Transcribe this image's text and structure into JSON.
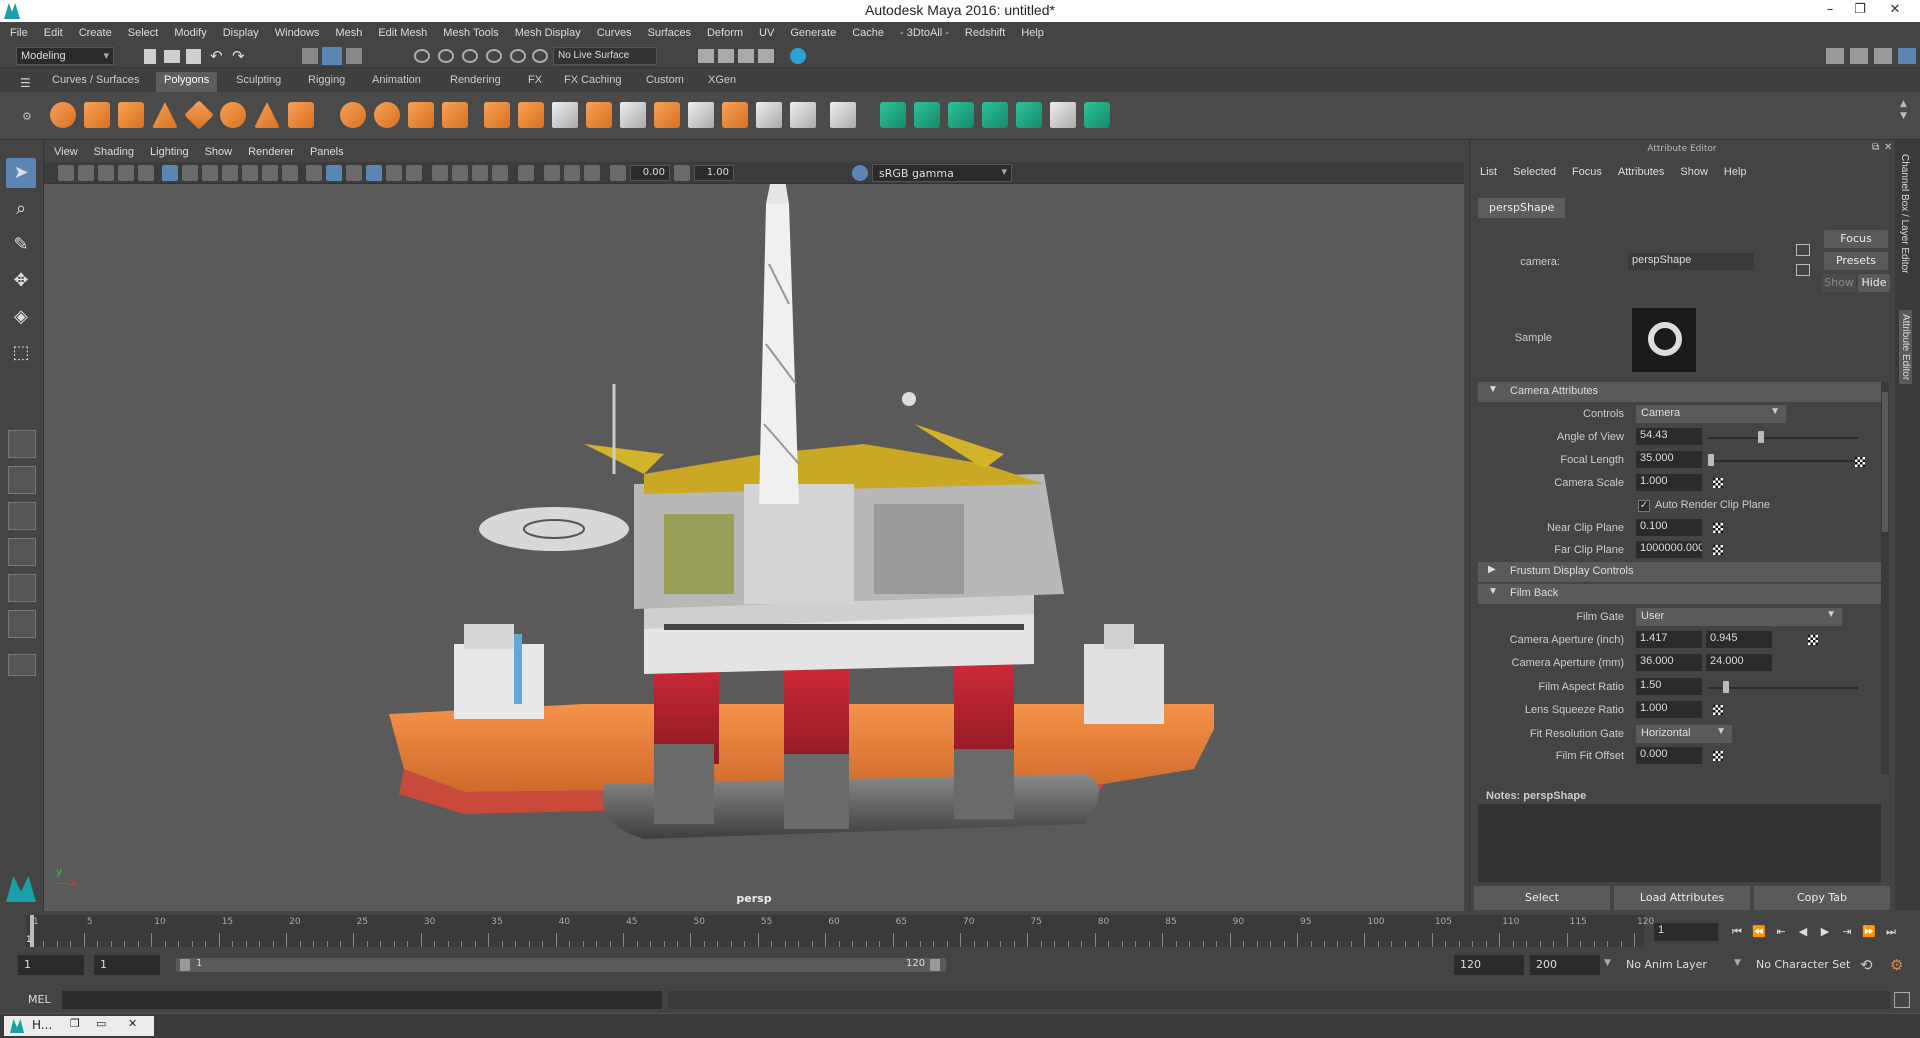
{
  "window": {
    "title": "Autodesk Maya 2016: untitled*"
  },
  "menus": [
    "File",
    "Edit",
    "Create",
    "Select",
    "Modify",
    "Display",
    "Windows",
    "Mesh",
    "Edit Mesh",
    "Mesh Tools",
    "Mesh Display",
    "Curves",
    "Surfaces",
    "Deform",
    "UV",
    "Generate",
    "Cache",
    "- 3DtoAll -",
    "Redshift",
    "Help"
  ],
  "status": {
    "mode": "Modeling",
    "live_surface": "No Live Surface"
  },
  "shelf": {
    "tabs": [
      "Curves / Surfaces",
      "Polygons",
      "Sculpting",
      "Rigging",
      "Animation",
      "Rendering",
      "FX",
      "FX Caching",
      "Custom",
      "XGen"
    ],
    "active_tab": "Polygons"
  },
  "viewport": {
    "menus": [
      "View",
      "Shading",
      "Lighting",
      "Show",
      "Renderer",
      "Panels"
    ],
    "near_value": "0.00",
    "exposure_value": "1.00",
    "color_space": "sRGB gamma",
    "camera_label": "persp"
  },
  "attr": {
    "header": "Attribute Editor",
    "menus": [
      "List",
      "Selected",
      "Focus",
      "Attributes",
      "Show",
      "Help"
    ],
    "node_tab": "perspShape",
    "camera_label": "camera:",
    "camera_value": "perspShape",
    "focus": "Focus",
    "presets": "Presets",
    "show": "Show",
    "hide": "Hide",
    "sample": "Sample",
    "sections": {
      "camera_attributes": "Camera Attributes",
      "frustum": "Frustum Display Controls",
      "film_back": "Film Back"
    },
    "fields": {
      "controls_label": "Controls",
      "controls_value": "Camera",
      "aov_label": "Angle of View",
      "aov_value": "54.43",
      "aov_level": 0.33,
      "focal_label": "Focal Length",
      "focal_value": "35.000",
      "focal_level": 0.0,
      "cam_scale_label": "Camera Scale",
      "cam_scale_value": "1.000",
      "auto_clip": "Auto Render Clip Plane",
      "near_label": "Near Clip Plane",
      "near_value": "0.100",
      "far_label": "Far Clip Plane",
      "far_value": "1000000.000",
      "film_gate_label": "Film Gate",
      "film_gate_value": "User",
      "ap_inch_label": "Camera Aperture (inch)",
      "ap_inch_1": "1.417",
      "ap_inch_2": "0.945",
      "ap_mm_label": "Camera Aperture (mm)",
      "ap_mm_1": "36.000",
      "ap_mm_2": "24.000",
      "far_ratio_label": "Film Aspect Ratio",
      "far_ratio_value": "1.50",
      "far_ratio_level": 0.1,
      "lens_label": "Lens Squeeze Ratio",
      "lens_value": "1.000",
      "fit_gate_label": "Fit Resolution Gate",
      "fit_gate_value": "Horizontal",
      "fit_offset_label": "Film Fit Offset",
      "fit_offset_value": "0.000"
    },
    "notes_label": "Notes:  perspShape",
    "buttons": {
      "select": "Select",
      "load": "Load Attributes",
      "copy": "Copy Tab"
    }
  },
  "vtabs": {
    "channel": "Channel Box / Layer Editor",
    "attr": "Attribute Editor"
  },
  "timeline": {
    "ticks": [
      "1",
      "5",
      "10",
      "15",
      "20",
      "25",
      "30",
      "35",
      "40",
      "45",
      "50",
      "55",
      "60",
      "65",
      "70",
      "75",
      "80",
      "85",
      "90",
      "95",
      "100",
      "105",
      "110",
      "115",
      "120"
    ],
    "current": "1",
    "current_field": "1"
  },
  "range": {
    "start": "1",
    "start2": "1",
    "bar_start": "1",
    "bar_end": "120",
    "end": "120",
    "end2": "200",
    "anim_layer": "No Anim Layer",
    "char_set": "No Character Set"
  },
  "cmd": {
    "mel": "MEL"
  },
  "taskbar": {
    "app": "H..."
  }
}
